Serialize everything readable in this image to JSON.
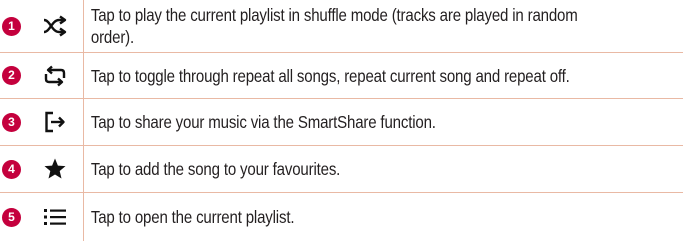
{
  "rows": [
    {
      "number": "1",
      "icon": "shuffle-icon",
      "description": "Tap to play the current playlist in shuffle mode (tracks are played in random order)."
    },
    {
      "number": "2",
      "icon": "repeat-icon",
      "description": "Tap to toggle through repeat all songs, repeat current song and repeat off."
    },
    {
      "number": "3",
      "icon": "share-icon",
      "description": "Tap to share your music via the SmartShare function."
    },
    {
      "number": "4",
      "icon": "star-icon",
      "description": "Tap to add the song to your favourites."
    },
    {
      "number": "5",
      "icon": "playlist-icon",
      "description": "Tap to open the current playlist."
    }
  ],
  "colors": {
    "badge": "#c4003d",
    "border": "#e9b9a4",
    "text": "#231f20"
  }
}
